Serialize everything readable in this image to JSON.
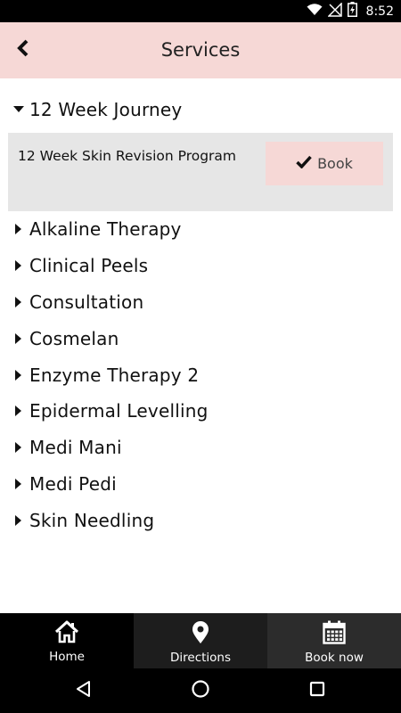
{
  "status_bar": {
    "time": "8:52"
  },
  "header": {
    "title": "Services"
  },
  "expanded_category": {
    "label": "12 Week Journey",
    "services": [
      {
        "name": "12 Week Skin Revision Program",
        "book_label": "Book"
      }
    ]
  },
  "categories": [
    "Alkaline Therapy",
    "Clinical Peels",
    "Consultation",
    "Cosmelan",
    "Enzyme Therapy 2",
    "Epidermal Levelling",
    "Medi Mani",
    "Medi Pedi",
    "Skin Needling"
  ],
  "tabbar": {
    "home": {
      "label": "Home",
      "icon": "home-icon"
    },
    "directions": {
      "label": "Directions",
      "icon": "map-pin-icon"
    },
    "book_now": {
      "label": "Book now",
      "icon": "calendar-icon"
    }
  },
  "colors": {
    "header_bg": "#f6d8d6",
    "panel_bg": "#e6e6e6",
    "tabbar_bg": "#000000"
  }
}
